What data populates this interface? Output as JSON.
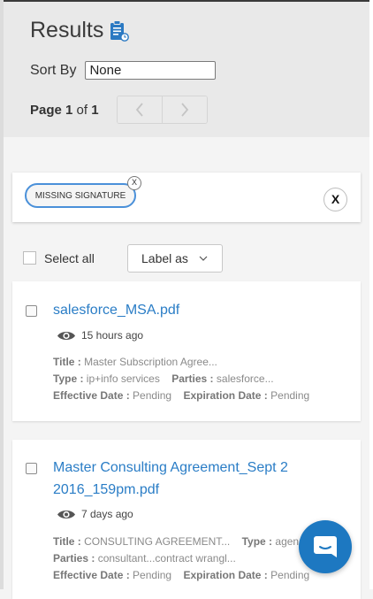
{
  "header": {
    "title": "Results",
    "title_icon": "clipboard-icon",
    "sort_label": "Sort By",
    "sort_value": "None",
    "page_word": "Page",
    "page_current": "1",
    "page_of": "of",
    "page_total": "1",
    "prev_icon": "chevron-left-icon",
    "next_icon": "chevron-right-icon"
  },
  "filters": {
    "chips": [
      {
        "label": "MISSING SIGNATURE",
        "remove": "X"
      }
    ],
    "clear_label": "X"
  },
  "bulk": {
    "select_all_label": "Select all",
    "label_as": "Label as",
    "label_as_icon": "chevron-down-icon"
  },
  "results": [
    {
      "title": "salesforce_MSA.pdf",
      "viewed": "15 hours ago",
      "title_label": "Title :",
      "title_value": "Master Subscription Agree...",
      "type_label": "Type :",
      "type_value": "ip+info services",
      "parties_label": "Parties :",
      "parties_value": "salesforce...",
      "effective_label": "Effective Date :",
      "effective_value": "Pending",
      "expiration_label": "Expiration Date :",
      "expiration_value": "Pending"
    },
    {
      "title": "Master Consulting Agreement_Sept 2 2016_159pm.pdf",
      "viewed": "7 days ago",
      "title_label": "Title :",
      "title_value": "CONSULTING AGREEMENT...",
      "type_label": "Type :",
      "type_value": "agen",
      "parties_label": "Parties :",
      "parties_value": "consultant...contract wrangl...",
      "effective_label": "Effective Date :",
      "effective_value": "Pending",
      "expiration_label": "Expiration Date :",
      "expiration_value": "Pending"
    }
  ],
  "chat": {
    "icon": "chat-bubble-icon"
  },
  "colors": {
    "link": "#2a7dc6",
    "accent": "#1d78c1",
    "chip_border": "#4a90d9"
  }
}
